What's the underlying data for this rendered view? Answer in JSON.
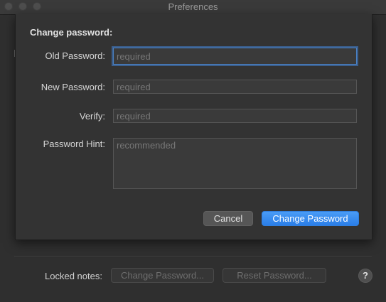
{
  "window": {
    "title": "Preferences"
  },
  "sheet": {
    "heading": "Change password:",
    "fields": [
      {
        "label": "Old Password:",
        "placeholder": "required"
      },
      {
        "label": "New Password:",
        "placeholder": "required"
      },
      {
        "label": "Verify:",
        "placeholder": "required"
      },
      {
        "label": "Password Hint:",
        "placeholder": "recommended"
      }
    ],
    "cancel_label": "Cancel",
    "submit_label": "Change Password"
  },
  "background": {
    "locked_notes_label": "Locked notes:",
    "change_password_label": "Change Password...",
    "reset_password_label": "Reset Password...",
    "help_label": "?"
  },
  "colors": {
    "accent": "#2a7ee8",
    "focus_ring": "#4a7fc0"
  }
}
